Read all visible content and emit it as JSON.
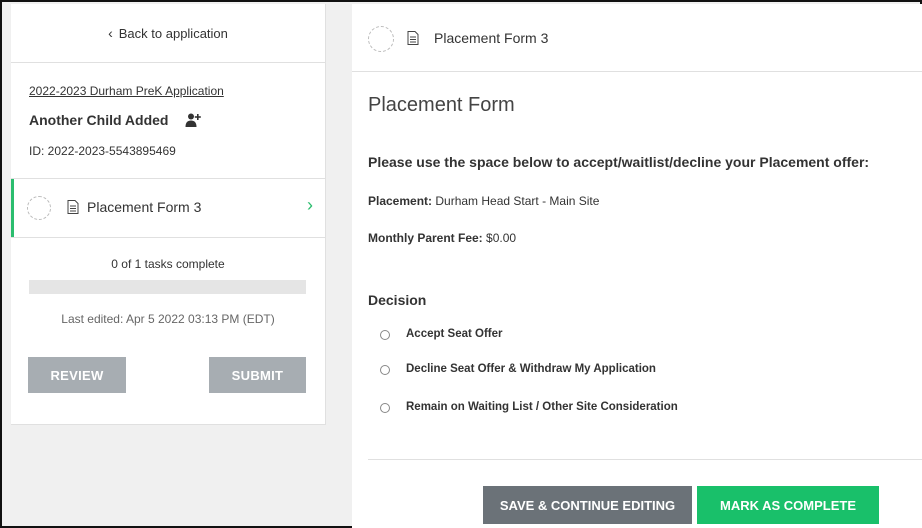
{
  "sidebar": {
    "back_label": "Back to application",
    "application_name": "2022-2023 Durham PreK Application",
    "child_name": "Another Child Added",
    "child_icon": "person-plus-icon",
    "application_id": "ID: 2022-2023-5543895469",
    "task": {
      "label": "Placement Form 3",
      "status_icon": "pending-circle-icon"
    },
    "tasks_complete_text": "0 of 1 tasks complete",
    "progress_fraction": 0,
    "last_edited": "Last edited: Apr 5 2022 03:13 PM (EDT)",
    "review_label": "REVIEW",
    "submit_label": "SUBMIT"
  },
  "main": {
    "header_label": "Placement Form 3",
    "form_title": "Placement Form",
    "instruction": "Please use the space below to accept/waitlist/decline your Placement offer:",
    "placement_label": "Placement:",
    "placement_value": "Durham Head Start - Main Site",
    "fee_label": "Monthly Parent Fee:",
    "fee_value": "$0.00",
    "decision_label": "Decision",
    "options": [
      "Accept Seat Offer",
      "Decline Seat Offer & Withdraw My Application",
      "Remain on Waiting List / Other Site Consideration"
    ],
    "save_label": "SAVE & CONTINUE EDITING",
    "complete_label": "MARK AS COMPLETE"
  },
  "colors": {
    "accent_green": "#19c06a",
    "grey_button": "#a7adb2",
    "dark_button": "#6b7278"
  }
}
